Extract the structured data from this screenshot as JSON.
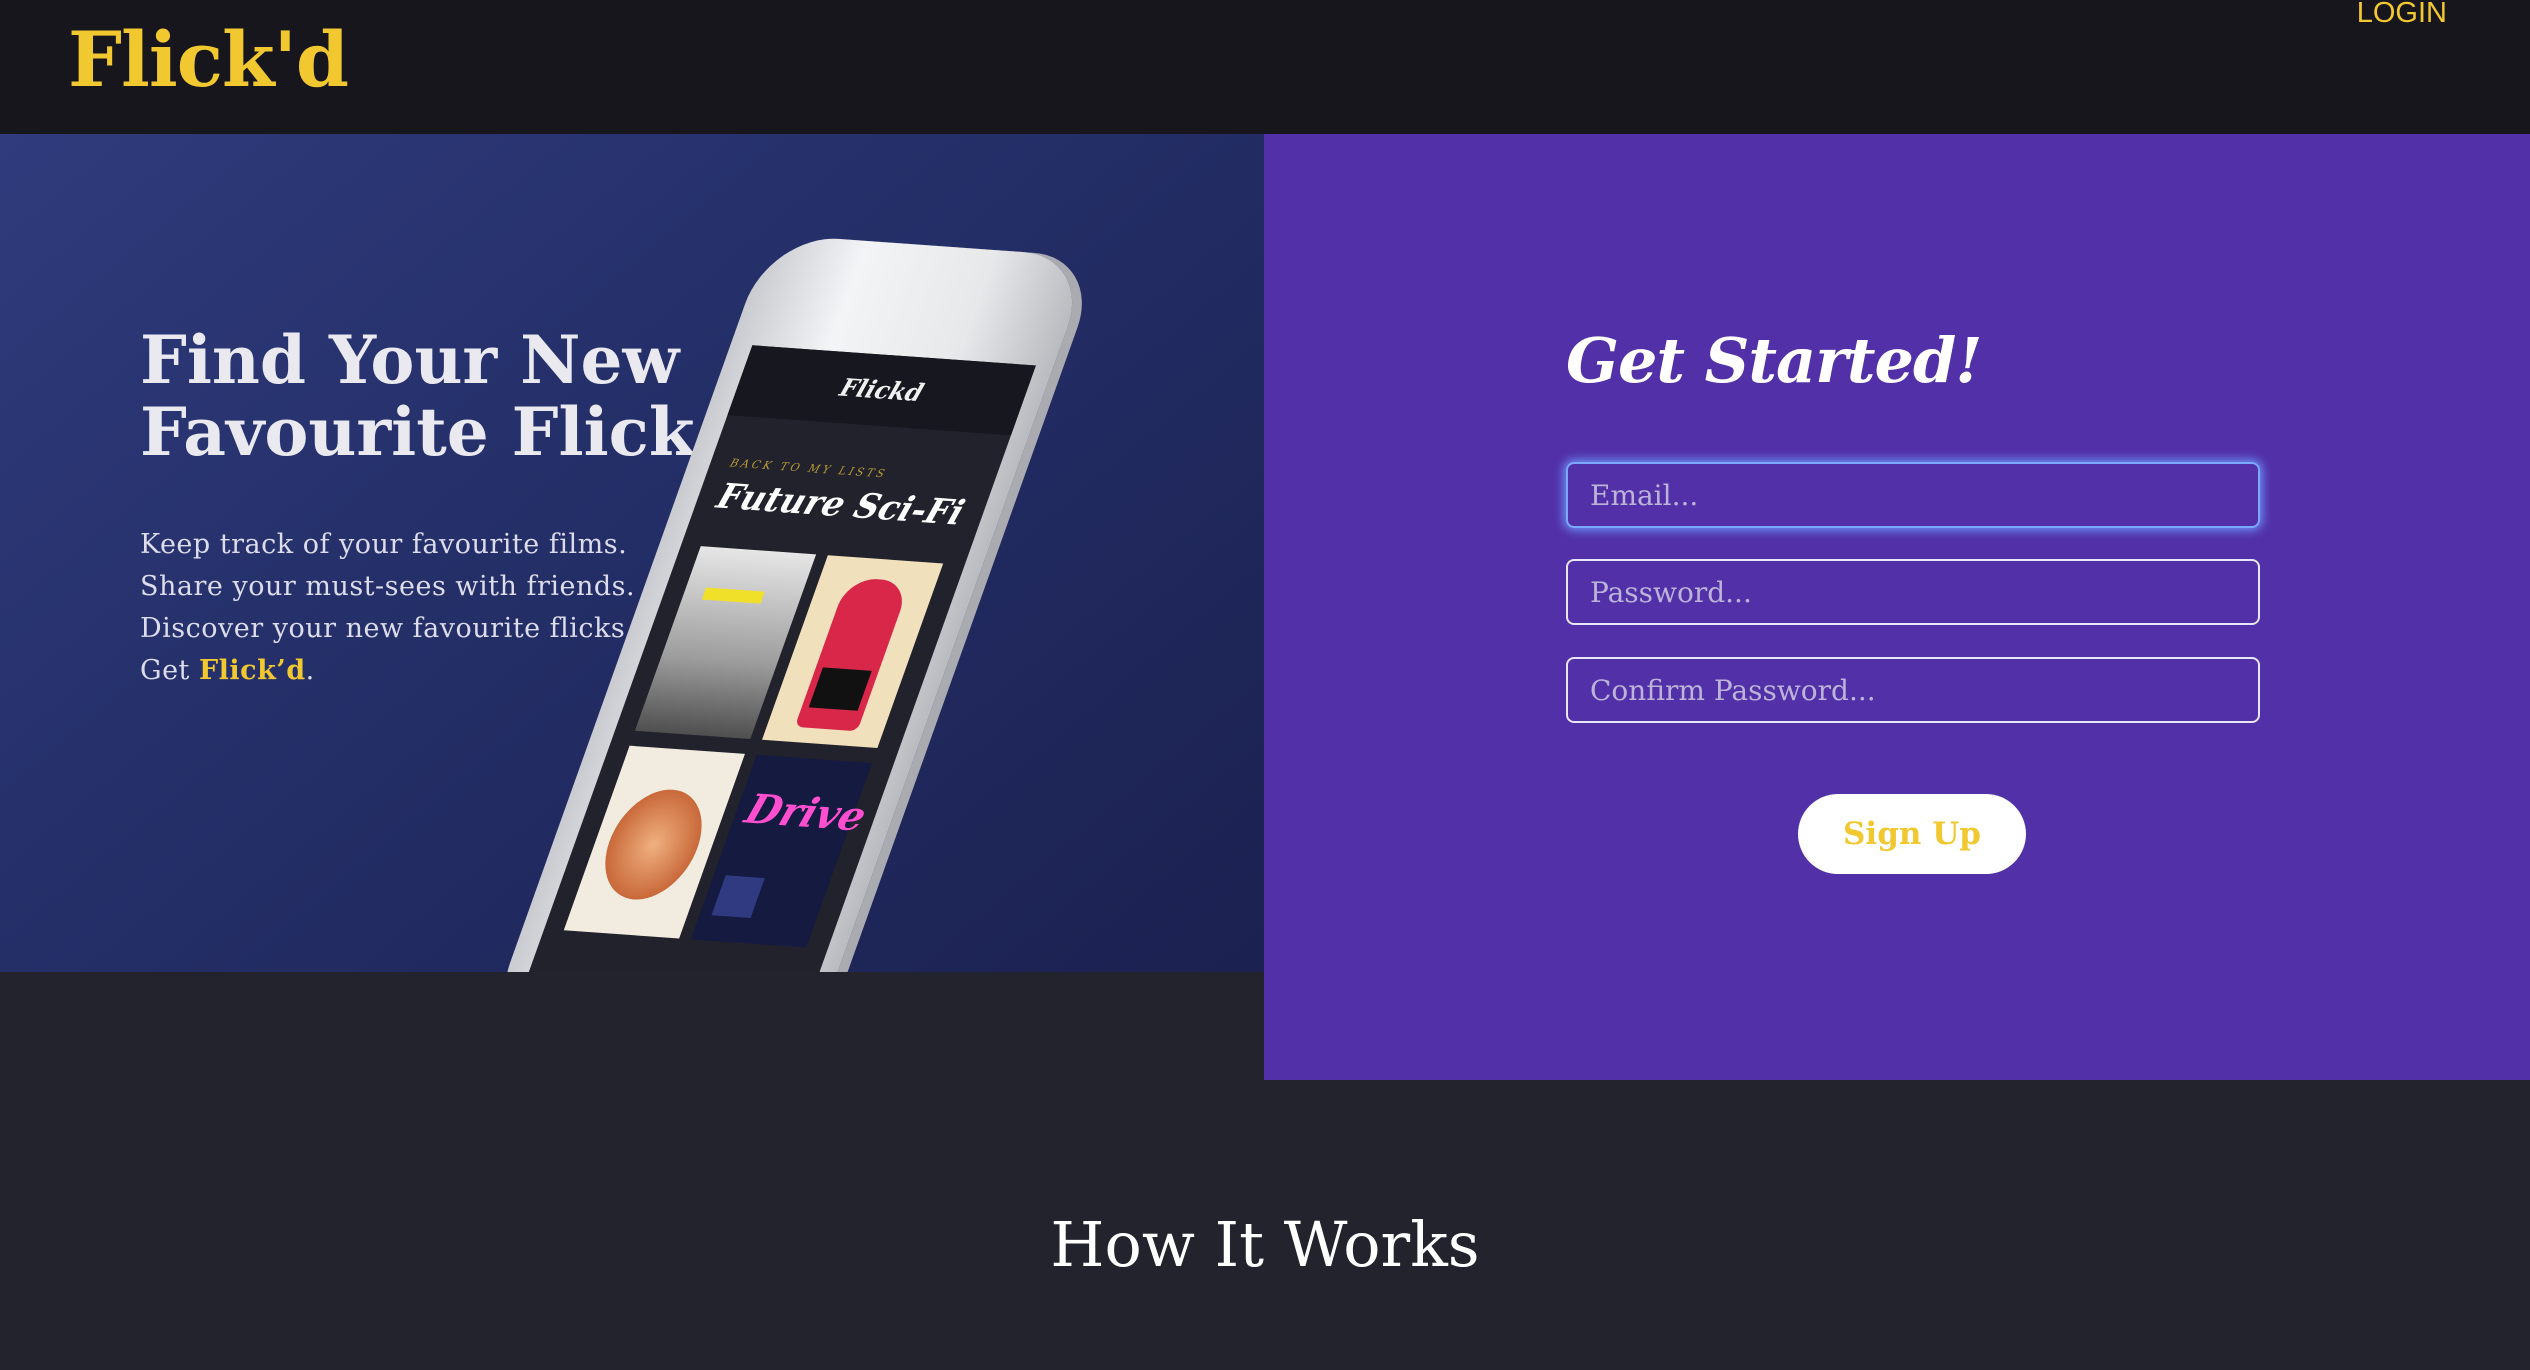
{
  "header": {
    "logo": "Flick'd",
    "login_label": "LOGIN"
  },
  "hero": {
    "title_line1": "Find Your New",
    "title_line2": "Favourite Flick.",
    "lines": [
      "Keep track of your favourite films.",
      "Share your must-sees with friends.",
      "Discover your new favourite flicks."
    ],
    "cta_prefix": "Get ",
    "cta_highlight": "Flick’d",
    "cta_suffix": "."
  },
  "phone": {
    "app_title": "Flickd",
    "back_link": "BACK TO MY LISTS",
    "list_title": "Future Sci-Fi",
    "poster_drive": "Drive"
  },
  "signup": {
    "title": "Get Started!",
    "email_placeholder": "Email...",
    "password_placeholder": "Password...",
    "confirm_placeholder": "Confirm Password...",
    "button_label": "Sign Up"
  },
  "how": {
    "title": "How It Works"
  },
  "colors": {
    "accent_yellow": "#f1c82f",
    "signup_purple": "#5230a8",
    "hero_blue": "#2f3b7c",
    "header_dark": "#16161c",
    "page_dark": "#23232d"
  }
}
